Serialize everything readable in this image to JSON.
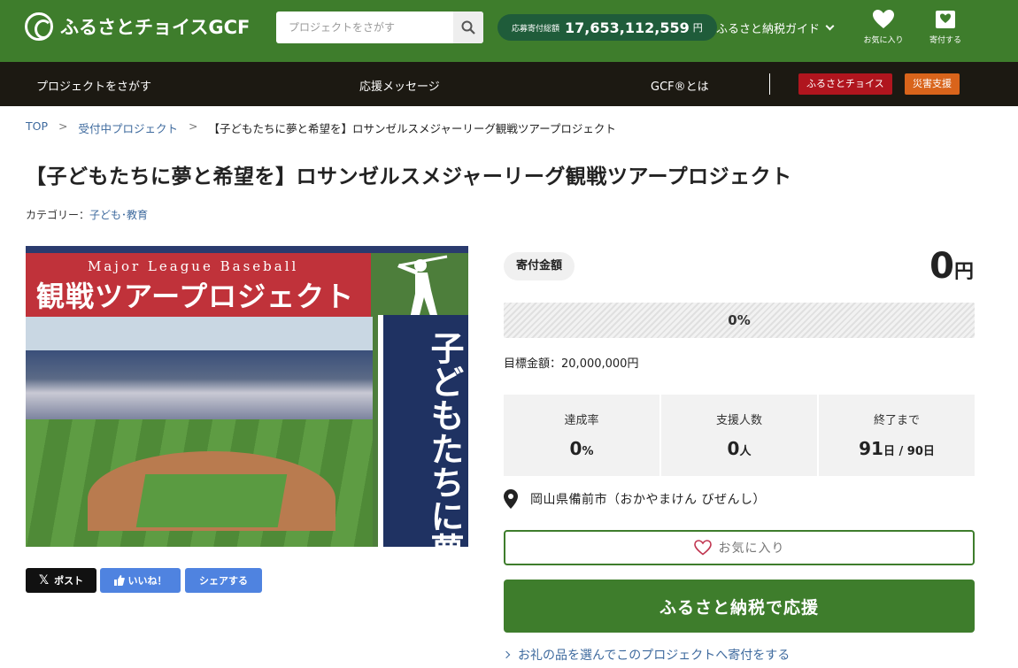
{
  "header": {
    "logo_text": "ふるさとチョイスGCF",
    "search_placeholder": "プロジェクトをさがす",
    "donation_total_label": "応募寄付総額",
    "donation_total_value": "17,653,112,559",
    "donation_total_unit": "円",
    "guide_label": "ふるさと納税ガイド",
    "favorites_label": "お気に入り",
    "donate_label": "寄付する"
  },
  "nav": {
    "find_projects": "プロジェクトをさがす",
    "messages": "応援メッセージ",
    "about_gcf": "GCF®とは",
    "furusato_choice": "ふるさとチョイス",
    "disaster_support": "災害支援",
    "colors": {
      "furusato_choice": "#b0151e",
      "disaster_support": "#d9641b"
    }
  },
  "breadcrumb": {
    "top": "TOP",
    "accepting": "受付中プロジェクト",
    "current": "【子どもたちに夢と希望を】ロサンゼルスメジャーリーグ観戦ツアープロジェクト"
  },
  "project": {
    "title": "【子どもたちに夢と希望を】ロサンゼルスメジャーリーグ観戦ツアープロジェクト",
    "category_label": "カテゴリー：",
    "category_value": "子ども･教育",
    "image": {
      "subtitle": "Major League Baseball",
      "main_text": "観戦ツアープロジェクト",
      "vertical_text": "子どもたちに夢と希望を"
    }
  },
  "share": {
    "post": "ポスト",
    "like": "いいね！",
    "share": "シェアする"
  },
  "funding": {
    "amount_label": "寄付金額",
    "amount_value": "0",
    "amount_unit": "円",
    "progress_percent": 0,
    "progress_label": "0%",
    "target_label": "目標金額：",
    "target_value": "20,000,000円",
    "stats": [
      {
        "label": "達成率",
        "value": "0",
        "unit": "%"
      },
      {
        "label": "支援人数",
        "value": "0",
        "unit": "人"
      },
      {
        "label": "終了まで",
        "value": "91",
        "unit": "日 / 90日"
      }
    ],
    "location": "岡山県備前市（おかやまけん びぜんし）",
    "favorite_button": "お気に入り",
    "cta_button": "ふるさと納税で応援",
    "gift_link": "お礼の品を選んでこのプロジェクトへ寄付をする",
    "accent_color": "#3e7d2c"
  }
}
